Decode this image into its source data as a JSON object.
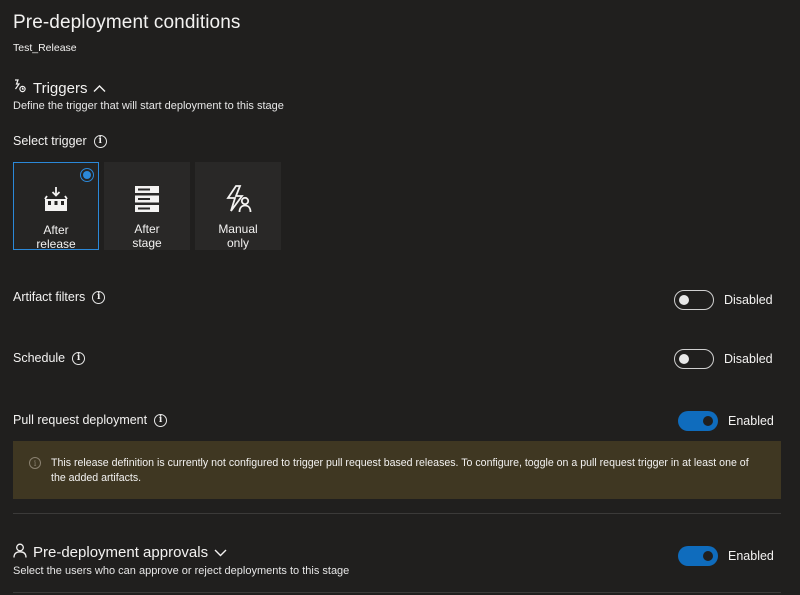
{
  "panel": {
    "title": "Pre-deployment conditions",
    "subtitle": "Test_Release"
  },
  "triggers": {
    "heading": "Triggers",
    "description": "Define the trigger that will start deployment to this stage",
    "select_label": "Select trigger",
    "options": [
      {
        "line1": "After",
        "line2": "release",
        "icon": "release-icon",
        "selected": true
      },
      {
        "line1": "After",
        "line2": "stage",
        "icon": "stage-icon",
        "selected": false
      },
      {
        "line1": "Manual",
        "line2": "only",
        "icon": "manual-icon",
        "selected": false
      }
    ]
  },
  "artifact_filters": {
    "label": "Artifact filters",
    "status": "Disabled",
    "enabled": false
  },
  "schedule": {
    "label": "Schedule",
    "status": "Disabled",
    "enabled": false
  },
  "pull_request": {
    "label": "Pull request deployment",
    "status": "Enabled",
    "enabled": true,
    "warning": "This release definition is currently not configured to trigger pull request based releases. To configure, toggle on a pull request trigger in at least one of the added artifacts."
  },
  "approvals": {
    "heading": "Pre-deployment approvals",
    "description": "Select the users who can approve or reject deployments to this stage",
    "status": "Enabled",
    "enabled": true
  },
  "colors": {
    "accent": "#0f6cbd",
    "background": "#201f1e",
    "warning_bg": "#3f3722"
  }
}
